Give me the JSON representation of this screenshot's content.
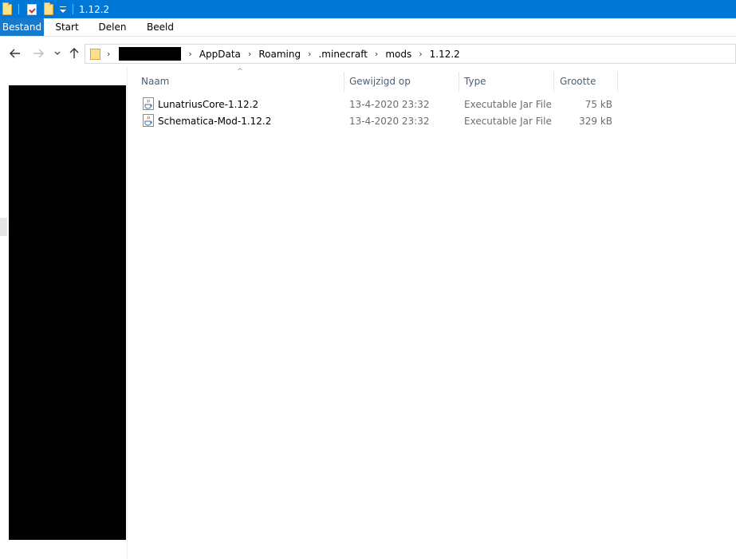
{
  "window": {
    "title": "1.12.2"
  },
  "quick_access": {
    "icons": [
      "folder-icon",
      "properties-icon",
      "new-folder-icon",
      "customize-quick-access-icon"
    ]
  },
  "ribbon": {
    "tabs": [
      {
        "label": "Bestand"
      },
      {
        "label": "Start"
      },
      {
        "label": "Delen"
      },
      {
        "label": "Beeld"
      }
    ]
  },
  "breadcrumb": [
    "AppData",
    "Roaming",
    ".minecraft",
    "mods",
    "1.12.2"
  ],
  "columns": {
    "name": "Naam",
    "modified": "Gewijzigd op",
    "type": "Type",
    "size": "Grootte"
  },
  "files": [
    {
      "name": "LunatriusCore-1.12.2",
      "modified": "13-4-2020 23:32",
      "type": "Executable Jar File",
      "size": "75 kB",
      "icon": "java-jar-icon"
    },
    {
      "name": "Schematica-Mod-1.12.2",
      "modified": "13-4-2020 23:32",
      "type": "Executable Jar File",
      "size": "329 kB",
      "icon": "java-jar-icon"
    }
  ],
  "colors": {
    "titlebar": "#0078d7",
    "file_tab": "#1979ca",
    "header_text": "#4c607a"
  }
}
